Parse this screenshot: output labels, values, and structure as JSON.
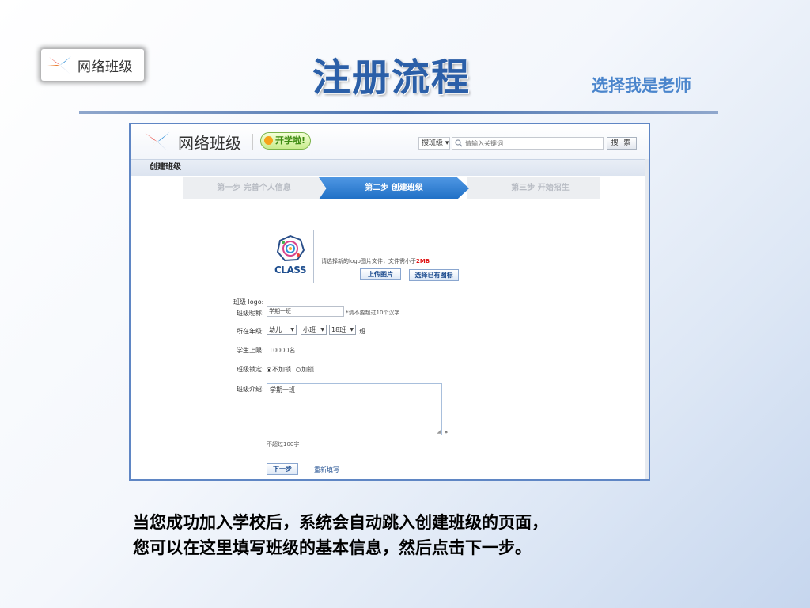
{
  "slide": {
    "logo_text": "网络班级",
    "title": "注册流程",
    "subtitle": "选择我是老师",
    "caption_line1": "当您成功加入学校后，系统会自动跳入创建班级的页面，",
    "caption_line2": "您可以在这里填写班级的基本信息，然后点击下一步。"
  },
  "site": {
    "logo_text": "网络班级",
    "badge_text": "开学啦!",
    "search_scope": "搜班级 ▾",
    "search_placeholder": "请输入关键词",
    "search_button": "搜 索"
  },
  "page": {
    "section_title": "创建班级",
    "steps": [
      {
        "label": "第一步 完善个人信息",
        "state": "done"
      },
      {
        "label": "第二步 创建班级",
        "state": "active"
      },
      {
        "label": "第三步 开始招生",
        "state": "todo"
      }
    ]
  },
  "form": {
    "logo_label": "班级 logo:",
    "logo_image_text": "CLASS",
    "logo_hint_prefix": "请选择新的logo图片文件，文件需小于",
    "logo_hint_limit": "2MB",
    "upload_button": "上传图片",
    "choose_icon_button": "选择已有图标",
    "nickname_label": "班级昵称:",
    "nickname_value": "学期一班",
    "nickname_note": "*请不要超过10个汉字",
    "grade_label": "所在年级:",
    "grade_stage": "幼儿",
    "grade_level": "小班",
    "grade_number": "18班",
    "grade_suffix": "班",
    "limit_label": "学生上限:",
    "limit_value": "10000名",
    "lock_label": "班级锁定:",
    "lock_option_unlocked": "不加锁",
    "lock_option_locked": "加锁",
    "lock_selected": "不加锁",
    "intro_label": "班级介绍:",
    "intro_value": "学期一班",
    "intro_required": "*",
    "intro_note": "不超过100字",
    "next_button": "下一步",
    "reset_link": "重新填写"
  },
  "colors": {
    "accent_blue": "#2b5fa8",
    "active_step": "#1f6fc5",
    "warning_red": "#e01010",
    "badge_green": "#3e8b12"
  },
  "icons": [
    "pinwheel-logo-icon",
    "search-icon",
    "class-logo-icon",
    "chevron-down-icon"
  ]
}
